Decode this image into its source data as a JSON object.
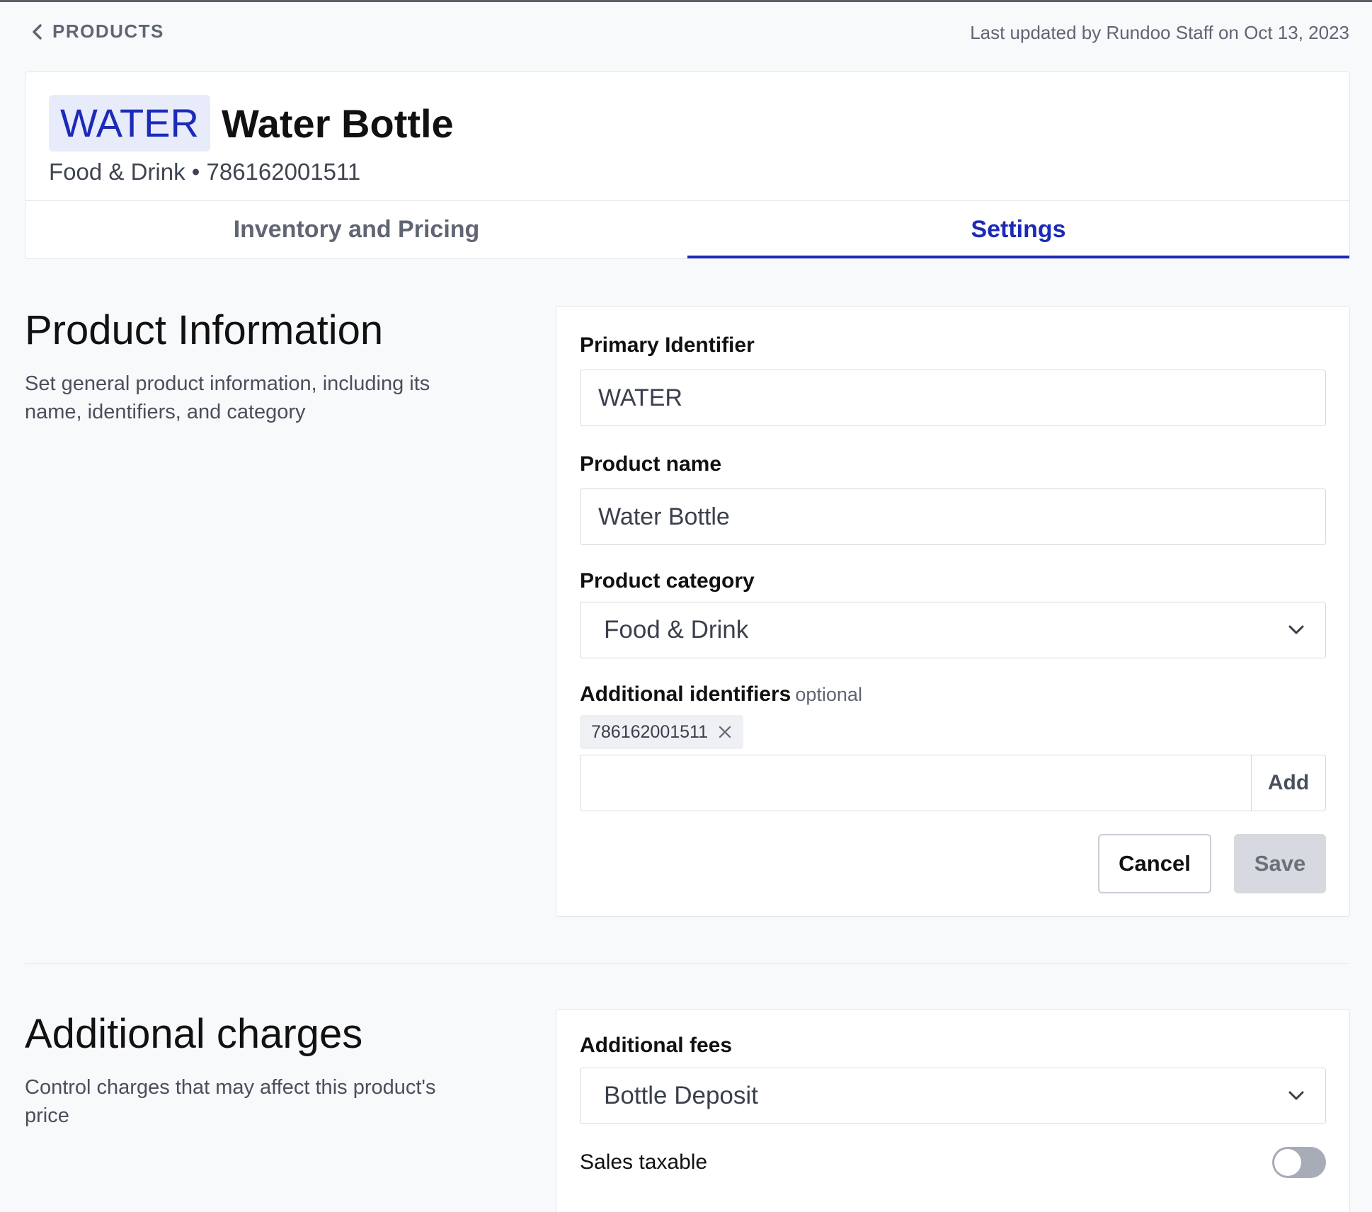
{
  "topbar": {
    "back_label": "PRODUCTS",
    "last_updated": "Last updated by Rundoo Staff on Oct 13, 2023"
  },
  "product": {
    "primary_id": "WATER",
    "name": "Water Bottle",
    "category": "Food & Drink",
    "separator": "•",
    "upc": "786162001511"
  },
  "tabs": [
    {
      "label": "Inventory and Pricing",
      "active": false
    },
    {
      "label": "Settings",
      "active": true
    }
  ],
  "product_info": {
    "heading": "Product Information",
    "description": "Set general product information, including its name, identifiers, and category",
    "primary_identifier": {
      "label": "Primary Identifier",
      "value": "WATER"
    },
    "product_name": {
      "label": "Product name",
      "value": "Water Bottle"
    },
    "product_category": {
      "label": "Product category",
      "value": "Food & Drink"
    },
    "additional_identifiers": {
      "label": "Additional identifiers",
      "optional_label": "optional",
      "tags": [
        "786162001511"
      ],
      "input_value": "",
      "add_label": "Add"
    },
    "cancel_label": "Cancel",
    "save_label": "Save"
  },
  "additional_charges": {
    "heading": "Additional charges",
    "description": "Control charges that may affect this product's price",
    "fees": {
      "label": "Additional fees",
      "value": "Bottle Deposit"
    },
    "sales_taxable": {
      "label": "Sales taxable",
      "enabled": false
    }
  },
  "colors": {
    "accent": "#1b2ab8",
    "chip_bg": "#e8ebf9",
    "page_bg": "#f8f9fb"
  }
}
